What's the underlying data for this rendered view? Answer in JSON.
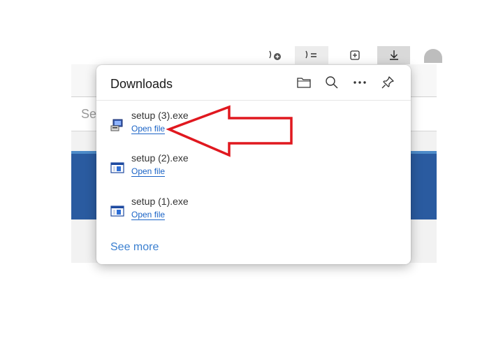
{
  "toolbar": {
    "icons": [
      "collections-add-icon",
      "favorites-list-icon",
      "add-collection-icon",
      "downloads-icon",
      "profile-icon"
    ]
  },
  "background": {
    "search_partial": "Se"
  },
  "downloads": {
    "title": "Downloads",
    "header_icons": [
      "folder-icon",
      "search-icon",
      "more-options-icon",
      "pin-icon"
    ],
    "items": [
      {
        "name": "setup (3).exe",
        "action": "Open file",
        "icon": "installer-exe-icon"
      },
      {
        "name": "setup (2).exe",
        "action": "Open file",
        "icon": "application-exe-icon"
      },
      {
        "name": "setup (1).exe",
        "action": "Open file",
        "icon": "application-exe-icon"
      }
    ],
    "see_more": "See more"
  },
  "annotation": {
    "arrow_color": "#e0181f",
    "points_to": "Open file"
  }
}
